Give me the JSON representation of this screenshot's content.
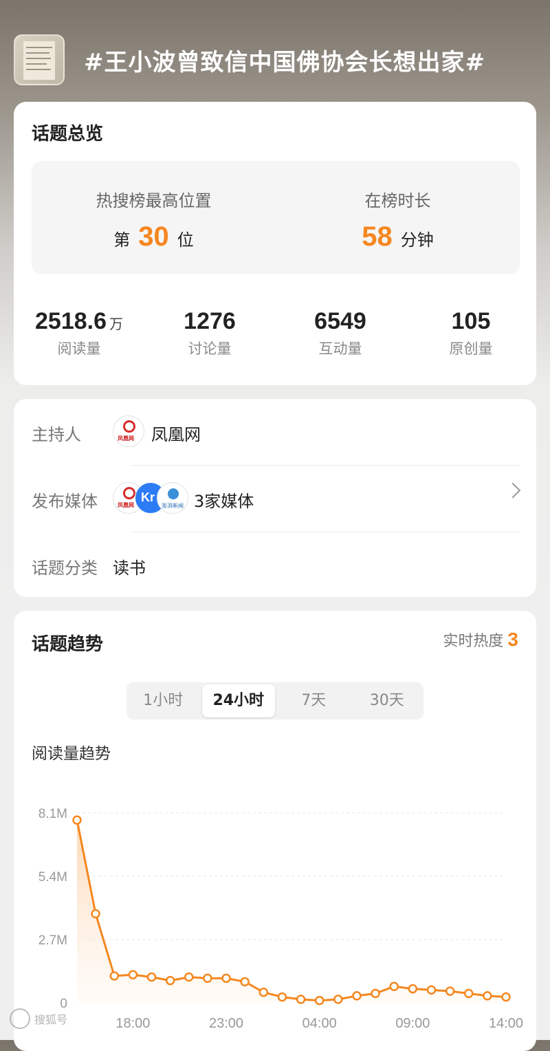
{
  "header": {
    "title": "#王小波曾致信中国佛协会长想出家#"
  },
  "overview": {
    "title": "话题总览",
    "rank_label": "热搜榜最高位置",
    "rank_prefix": "第",
    "rank_value": "30",
    "rank_suffix": "位",
    "duration_label": "在榜时长",
    "duration_value": "58",
    "duration_unit": "分钟",
    "stats": [
      {
        "value": "2518.6",
        "unit": "万",
        "label": "阅读量"
      },
      {
        "value": "1276",
        "unit": "",
        "label": "讨论量"
      },
      {
        "value": "6549",
        "unit": "",
        "label": "互动量"
      },
      {
        "value": "105",
        "unit": "",
        "label": "原创量"
      }
    ]
  },
  "info": {
    "host_label": "主持人",
    "host_value": "凤凰网",
    "media_label": "发布媒体",
    "media_value": "3家媒体",
    "category_label": "话题分类",
    "category_value": "读书",
    "icons": [
      "ifeng-logo-icon",
      "36kr-logo-icon",
      "paper-logo-icon",
      "chevron-right-icon"
    ]
  },
  "trend": {
    "title": "话题趋势",
    "realtime_label": "实时热度",
    "realtime_value": "3",
    "tabs": [
      "1小时",
      "24小时",
      "7天",
      "30天"
    ],
    "active_tab": "24小时",
    "chart_title": "阅读量趋势"
  },
  "chart_data": {
    "type": "area",
    "title": "阅读量趋势",
    "y_tick_labels": [
      "0",
      "2.7M",
      "5.4M",
      "8.1M"
    ],
    "x_tick_labels": [
      "18:00",
      "23:00",
      "04:00",
      "09:00",
      "14:00"
    ],
    "ylim": [
      0,
      8100000
    ],
    "grid": true,
    "colors": {
      "line": "#f5871f",
      "fill_top": "#fbd3ad",
      "fill_bottom": "#fff6ee"
    },
    "values": [
      7800000,
      3800000,
      1150000,
      1200000,
      1100000,
      950000,
      1100000,
      1050000,
      1050000,
      900000,
      450000,
      250000,
      150000,
      100000,
      150000,
      300000,
      400000,
      700000,
      600000,
      550000,
      500000,
      400000,
      300000,
      250000
    ]
  },
  "watermark": {
    "text": "搜狐号"
  }
}
